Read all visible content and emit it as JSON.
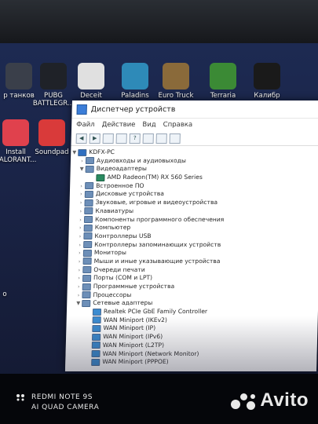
{
  "desktop": {
    "icons_row1": [
      {
        "label": "р танков",
        "color": "#3a3f4a"
      },
      {
        "label": "PUBG BATTLEGR...",
        "color": "#1f2228"
      },
      {
        "label": "Deceit",
        "color": "#e0e0e0"
      },
      {
        "label": "Paladins",
        "color": "#2e8ab8"
      },
      {
        "label": "Euro Truck",
        "color": "#8a6a3a"
      },
      {
        "label": "Terraria",
        "color": "#3b8a35"
      },
      {
        "label": "Калибр",
        "color": "#1a1a1a"
      }
    ],
    "icons_row2": [
      {
        "label": "Install VALORANT...",
        "color": "#e0414d"
      },
      {
        "label": "Soundpad",
        "color": "#d93a3a"
      }
    ],
    "left_partial_text": "о"
  },
  "window": {
    "title": "Диспетчер устройств",
    "menu": [
      "Файл",
      "Действие",
      "Вид",
      "Справка"
    ],
    "root": "KDFX-PC",
    "tree": [
      {
        "label": "Аудиовходы и аудиовыходы",
        "expanded": false,
        "level": 1
      },
      {
        "label": "Видеоадаптеры",
        "expanded": true,
        "level": 1
      },
      {
        "label": "AMD Radeon(TM) RX 560 Series",
        "expanded": false,
        "level": 2
      },
      {
        "label": "Встроенное ПО",
        "expanded": false,
        "level": 1
      },
      {
        "label": "Дисковые устройства",
        "expanded": false,
        "level": 1
      },
      {
        "label": "Звуковые, игровые и видеоустройства",
        "expanded": false,
        "level": 1
      },
      {
        "label": "Клавиатуры",
        "expanded": false,
        "level": 1
      },
      {
        "label": "Компоненты программного обеспечения",
        "expanded": false,
        "level": 1
      },
      {
        "label": "Компьютер",
        "expanded": false,
        "level": 1
      },
      {
        "label": "Контроллеры USB",
        "expanded": false,
        "level": 1
      },
      {
        "label": "Контроллеры запоминающих устройств",
        "expanded": false,
        "level": 1
      },
      {
        "label": "Мониторы",
        "expanded": false,
        "level": 1
      },
      {
        "label": "Мыши и иные указывающие устройства",
        "expanded": false,
        "level": 1
      },
      {
        "label": "Очереди печати",
        "expanded": false,
        "level": 1
      },
      {
        "label": "Порты (COM и LPT)",
        "expanded": false,
        "level": 1
      },
      {
        "label": "Программные устройства",
        "expanded": false,
        "level": 1
      },
      {
        "label": "Процессоры",
        "expanded": false,
        "level": 1
      },
      {
        "label": "Сетевые адаптеры",
        "expanded": true,
        "level": 1
      },
      {
        "label": "Realtek PCIe GbE Family Controller",
        "expanded": false,
        "level": 2
      },
      {
        "label": "WAN Miniport (IKEv2)",
        "expanded": false,
        "level": 2
      },
      {
        "label": "WAN Miniport (IP)",
        "expanded": false,
        "level": 2
      },
      {
        "label": "WAN Miniport (IPv6)",
        "expanded": false,
        "level": 2
      },
      {
        "label": "WAN Miniport (L2TP)",
        "expanded": false,
        "level": 2
      },
      {
        "label": "WAN Miniport (Network Monitor)",
        "expanded": false,
        "level": 2
      },
      {
        "label": "WAN Miniport (PPPOE)",
        "expanded": false,
        "level": 2
      }
    ]
  },
  "photo_watermark": {
    "line1": "REDMI NOTE 9S",
    "line2": "AI QUAD CAMERA"
  },
  "avito_logo": "Avito"
}
